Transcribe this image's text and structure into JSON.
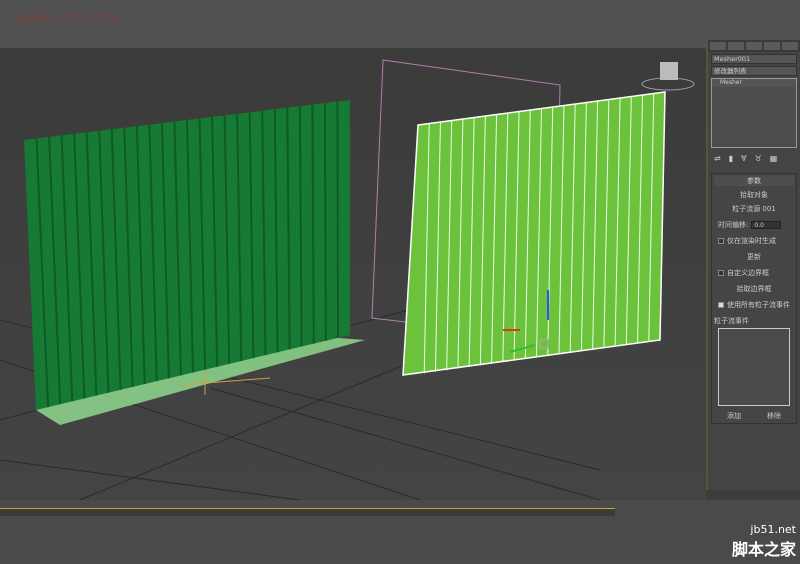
{
  "watermark": "WWW.3DXY.COM",
  "panel": {
    "object_name": "Mesher001",
    "modifier_list": "修改器列表",
    "stack_item": "Mesher",
    "rollout_title": "参数",
    "pick_object": "拾取对象",
    "source": "粒子流源 001",
    "time_offset_label": "时间偏移:",
    "time_offset_value": "0.0",
    "render_only": "仅在渲染时生成",
    "update": "更新",
    "custom_bbox": "自定义边界框",
    "pick_bbox": "拾取边界框",
    "use_all_events": "使用所有粒子流事件",
    "events_label": "粒子流事件",
    "add": "添加",
    "remove": "移除"
  },
  "logo": {
    "site": "jb51.net",
    "name": "脚本之家"
  }
}
